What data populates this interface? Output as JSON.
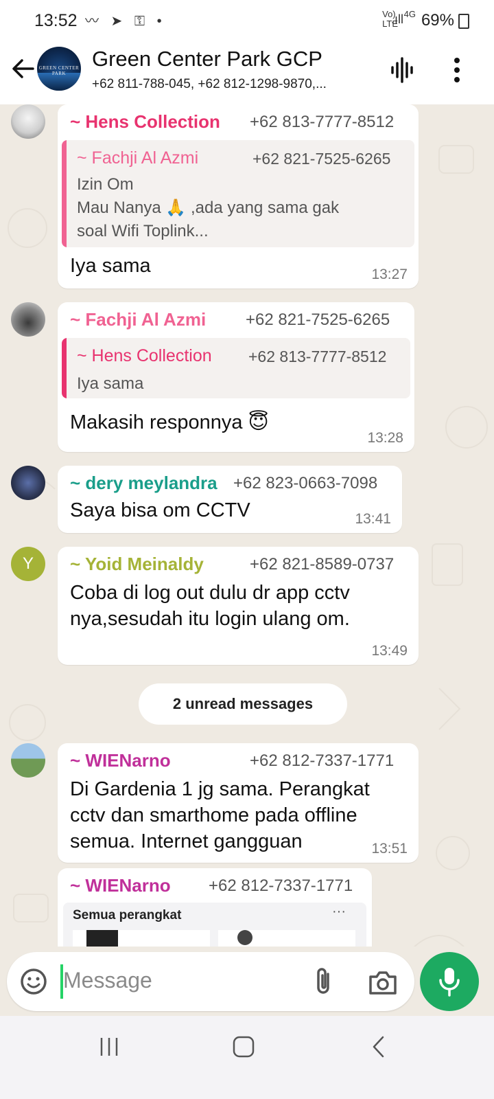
{
  "status_bar": {
    "time": "13:52",
    "battery": "69%",
    "network": "4G"
  },
  "header": {
    "title": "Green Center Park GCP",
    "subtitle": "+62 811-788-045, +62 812-1298-9870,...",
    "avatar_text": "GREEN CENTER PARK"
  },
  "messages": [
    {
      "sender": "~ Hens Collection",
      "phone": "+62 813-7777-8512",
      "color": "#e8336f",
      "quote": {
        "sender": "~ Fachji Al Azmi",
        "phone": "+62 821-7525-6265",
        "color": "#f06292",
        "lines": [
          "Izin Om",
          "Mau Nanya 🙏 ,ada yang sama gak",
          "soal Wifi Toplink..."
        ]
      },
      "text": [
        "Iya sama"
      ],
      "time": "13:27"
    },
    {
      "sender": "~ Fachji Al Azmi",
      "phone": "+62 821-7525-6265",
      "color": "#f06292",
      "quote": {
        "sender": "~ Hens Collection",
        "phone": "+62 813-7777-8512",
        "color": "#e8336f",
        "lines": [
          "Iya sama"
        ]
      },
      "text": [
        "Makasih responnya 😇"
      ],
      "time": "13:28"
    },
    {
      "sender": "~ dery meylandra",
      "phone": "+62 823-0663-7098",
      "color": "#1a9e8a",
      "text": [
        "Saya bisa om CCTV"
      ],
      "time": "13:41"
    },
    {
      "sender": "~ Yoid Meinaldy",
      "phone": "+62 821-8589-0737",
      "color": "#a5b337",
      "avatar_letter": "Y",
      "text": [
        "Coba di log out dulu dr app cctv",
        "nya,sesudah itu login ulang om."
      ],
      "time": "13:49"
    },
    {
      "sender": "~ WIENarno",
      "phone": "+62 812-7337-1771",
      "color": "#c0309a",
      "text": [
        "Di Gardenia 1 jg sama. Perangkat",
        "cctv dan smarthome pada offline",
        "semua. Internet gangguan"
      ],
      "time": "13:51"
    },
    {
      "sender": "~ WIENarno",
      "phone": "+62 812-7337-1771",
      "color": "#c0309a",
      "image_caption": "Semua perangkat",
      "image_more": "···"
    }
  ],
  "unread_banner": "2 unread messages",
  "input": {
    "placeholder": "Message"
  },
  "icons": [
    "back-arrow-icon",
    "voice-chat-icon",
    "more-vert-icon",
    "emoji-icon",
    "attach-icon",
    "camera-icon",
    "mic-icon"
  ]
}
